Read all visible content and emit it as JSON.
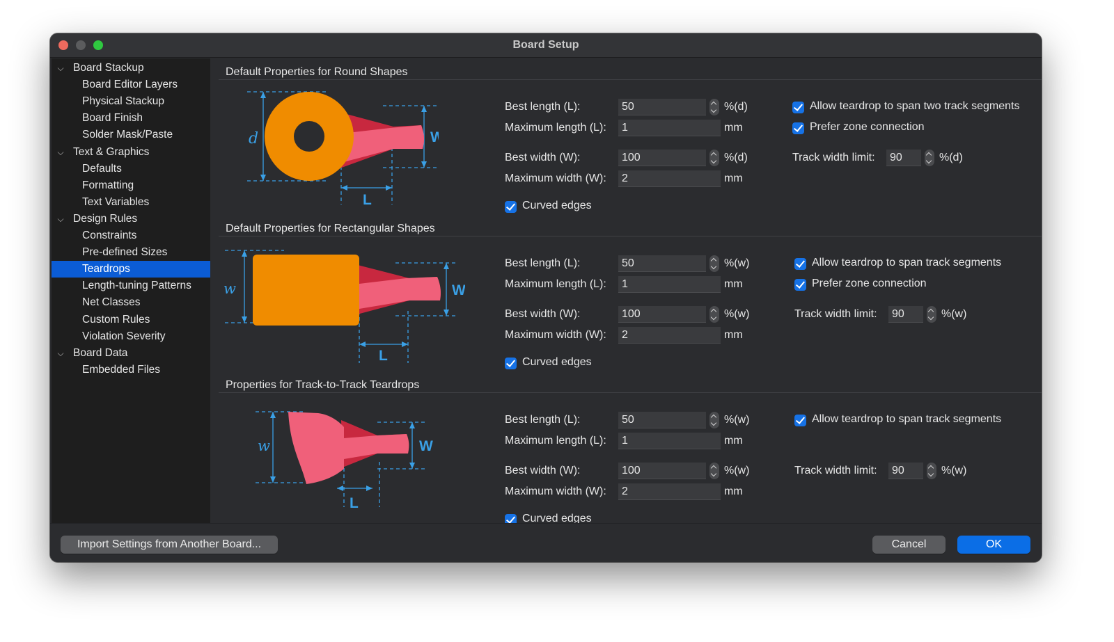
{
  "window": {
    "title": "Board Setup"
  },
  "sidebar": {
    "items": [
      {
        "label": "Board Stackup",
        "level": 0,
        "expanded": true
      },
      {
        "label": "Board Editor Layers",
        "level": 1
      },
      {
        "label": "Physical Stackup",
        "level": 1
      },
      {
        "label": "Board Finish",
        "level": 1
      },
      {
        "label": "Solder Mask/Paste",
        "level": 1
      },
      {
        "label": "Text & Graphics",
        "level": 0,
        "expanded": true
      },
      {
        "label": "Defaults",
        "level": 1
      },
      {
        "label": "Formatting",
        "level": 1
      },
      {
        "label": "Text Variables",
        "level": 1
      },
      {
        "label": "Design Rules",
        "level": 0,
        "expanded": true
      },
      {
        "label": "Constraints",
        "level": 1
      },
      {
        "label": "Pre-defined Sizes",
        "level": 1
      },
      {
        "label": "Teardrops",
        "level": 1,
        "selected": true
      },
      {
        "label": "Length-tuning Patterns",
        "level": 1
      },
      {
        "label": "Net Classes",
        "level": 1
      },
      {
        "label": "Custom Rules",
        "level": 1
      },
      {
        "label": "Violation Severity",
        "level": 1
      },
      {
        "label": "Board Data",
        "level": 0,
        "expanded": true
      },
      {
        "label": "Embedded Files",
        "level": 1
      }
    ]
  },
  "sections": [
    {
      "title": "Default Properties for Round Shapes",
      "diagram_labels": {
        "left": "d",
        "right": "W",
        "bottom": "L"
      },
      "best_length_label": "Best length (L):",
      "best_length_value": "50",
      "best_length_unit": "%(d)",
      "max_length_label": "Maximum length (L):",
      "max_length_value": "1",
      "max_length_unit": "mm",
      "best_width_label": "Best width (W):",
      "best_width_value": "100",
      "best_width_unit": "%(d)",
      "max_width_label": "Maximum width (W):",
      "max_width_value": "2",
      "max_width_unit": "mm",
      "curved_edges_label": "Curved edges",
      "span_label": "Allow teardrop to span two track segments",
      "prefer_zone_label": "Prefer zone connection",
      "track_limit_label": "Track width limit:",
      "track_limit_value": "90",
      "track_limit_unit": "%(d)"
    },
    {
      "title": "Default Properties for Rectangular Shapes",
      "diagram_labels": {
        "left": "w",
        "right": "W",
        "bottom": "L"
      },
      "best_length_label": "Best length (L):",
      "best_length_value": "50",
      "best_length_unit": "%(w)",
      "max_length_label": "Maximum length (L):",
      "max_length_value": "1",
      "max_length_unit": "mm",
      "best_width_label": "Best width (W):",
      "best_width_value": "100",
      "best_width_unit": "%(w)",
      "max_width_label": "Maximum width (W):",
      "max_width_value": "2",
      "max_width_unit": "mm",
      "curved_edges_label": "Curved edges",
      "span_label": "Allow teardrop to span track segments",
      "prefer_zone_label": "Prefer zone connection",
      "track_limit_label": "Track width limit:",
      "track_limit_value": "90",
      "track_limit_unit": "%(w)"
    },
    {
      "title": "Properties for Track-to-Track Teardrops",
      "diagram_labels": {
        "left": "w",
        "right": "W",
        "bottom": "L"
      },
      "best_length_label": "Best length (L):",
      "best_length_value": "50",
      "best_length_unit": "%(w)",
      "max_length_label": "Maximum length (L):",
      "max_length_value": "1",
      "max_length_unit": "mm",
      "best_width_label": "Best width (W):",
      "best_width_value": "100",
      "best_width_unit": "%(w)",
      "max_width_label": "Maximum width (W):",
      "max_width_value": "2",
      "max_width_unit": "mm",
      "curved_edges_label": "Curved edges",
      "span_label": "Allow teardrop to span track segments",
      "track_limit_label": "Track width limit:",
      "track_limit_value": "90",
      "track_limit_unit": "%(w)"
    }
  ],
  "footer": {
    "import_label": "Import Settings from Another Board...",
    "cancel_label": "Cancel",
    "ok_label": "OK"
  },
  "colors": {
    "accent": "#0b6ee6",
    "selection": "#0b5cd5",
    "pad_orange": "#f08c00",
    "teardrop_pink": "#f0607a",
    "teardrop_dark": "#c8283f",
    "dimension_blue": "#3aa0e6"
  }
}
